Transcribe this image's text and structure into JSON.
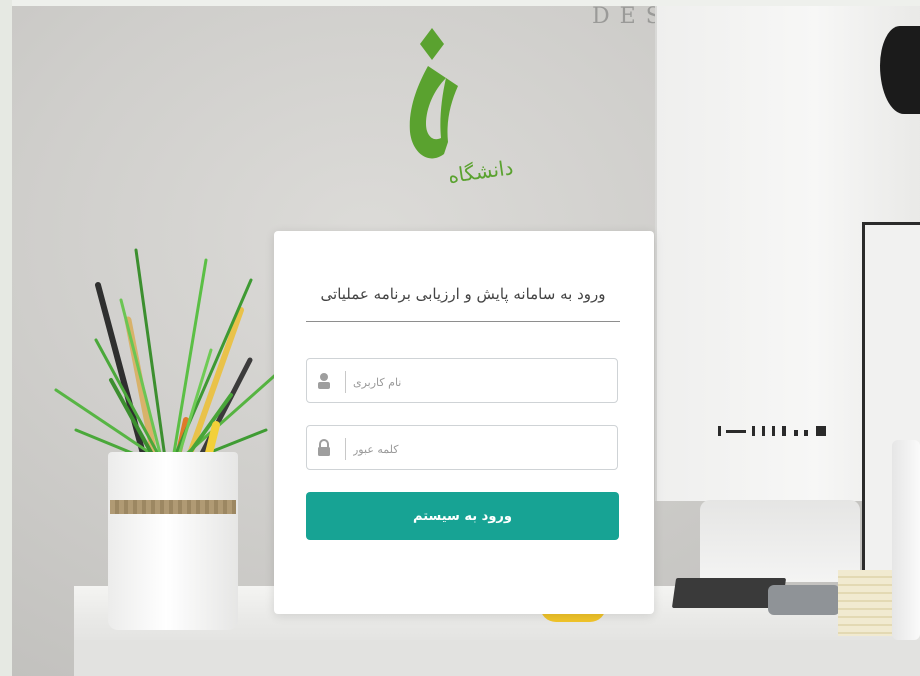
{
  "background": {
    "wall_lettering": "DES"
  },
  "logo": {
    "name": "university-logo",
    "color": "#5aa22f"
  },
  "login": {
    "title": "ورود به سامانه پایش و ارزیابی برنامه عملیاتی",
    "username": {
      "placeholder": "نام کاربری",
      "value": "",
      "icon": "user-icon"
    },
    "password": {
      "placeholder": "کلمه عبور",
      "value": "",
      "icon": "lock-icon"
    },
    "submit_label": "ورود به سیستم"
  },
  "colors": {
    "accent": "#17a394",
    "logo_green": "#5aa22f"
  }
}
